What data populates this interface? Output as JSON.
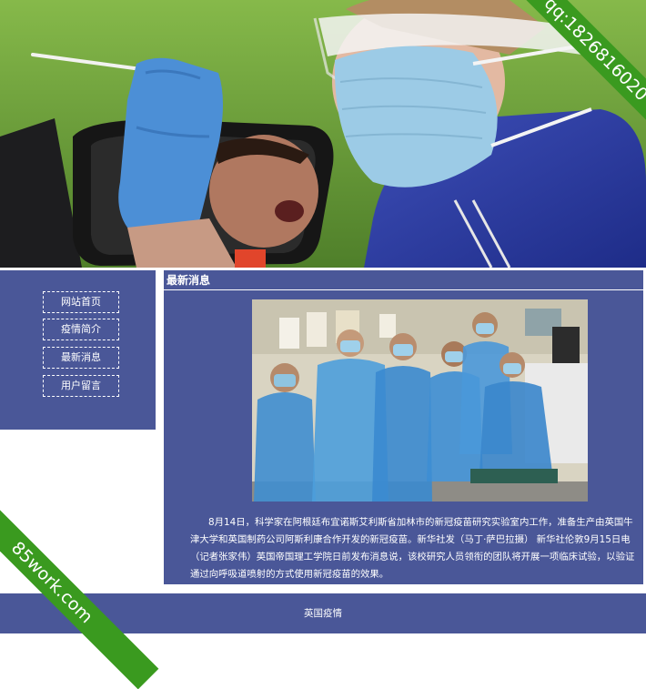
{
  "ribbons": {
    "top_right": "qq:1826816020",
    "bottom_left": "85work.com"
  },
  "sidebar": {
    "items": [
      {
        "label": "网站首页"
      },
      {
        "label": "疫情简介"
      },
      {
        "label": "最新消息"
      },
      {
        "label": "用户留言"
      }
    ]
  },
  "main": {
    "title": "最新消息",
    "article": "8月14日，科学家在阿根廷布宜诺斯艾利斯省加林市的新冠疫苗研究实验室内工作，准备生产由英国牛津大学和英国制药公司阿斯利康合作开发的新冠疫苗。新华社发（马丁·萨巴拉摄） 新华社伦敦9月15日电（记者张家伟）英国帝国理工学院日前发布消息说，该校研究人员领衔的团队将开展一项临床试验，以验证通过向呼吸道喷射的方式使用新冠疫苗的效果。"
  },
  "footer": {
    "text": "英国疫情"
  },
  "colors": {
    "panel": "#4a5798",
    "ribbon": "#3a9a1f"
  }
}
